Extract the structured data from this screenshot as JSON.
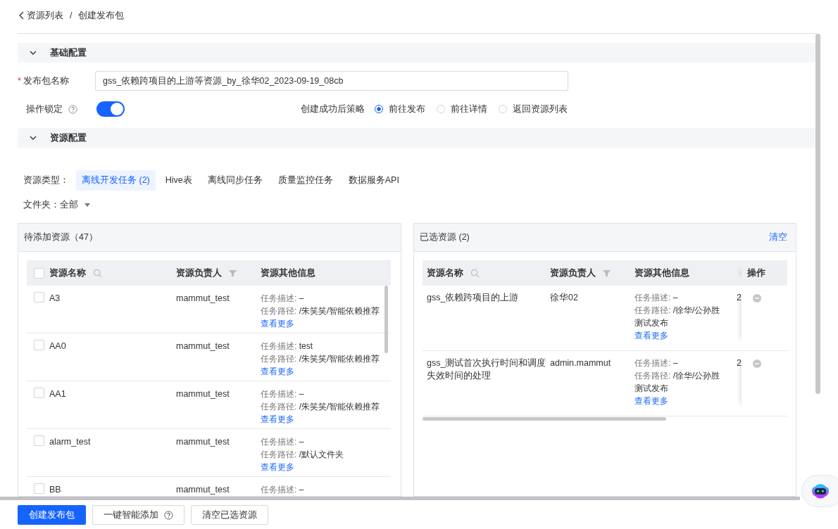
{
  "breadcrumb": {
    "back": "资源列表",
    "separator": "/",
    "current": "创建发布包"
  },
  "sections": [
    {
      "title": "基础配置",
      "expanded": true
    },
    {
      "title": "资源配置",
      "expanded": true
    }
  ],
  "basic": {
    "name_field": {
      "label": "发布包名称",
      "required_mark": "*",
      "value": "gss_依赖跨项目的上游等资源_by_徐华02_2023-09-19_08cb"
    },
    "lock": {
      "label": "操作锁定",
      "on": true
    },
    "strategy": {
      "label": "创建成功后策略",
      "options": [
        {
          "label": "前往发布",
          "selected": true
        },
        {
          "label": "前往详情",
          "selected": false
        },
        {
          "label": "返回资源列表",
          "selected": false
        }
      ]
    }
  },
  "resource": {
    "type_label": "资源类型：",
    "types": [
      {
        "label": "离线开发任务 (2)",
        "selected": true
      },
      {
        "label": "Hive表",
        "selected": false
      },
      {
        "label": "离线同步任务",
        "selected": false
      },
      {
        "label": "质量监控任务",
        "selected": false
      },
      {
        "label": "数据服务API",
        "selected": false
      }
    ],
    "folder": {
      "label": "文件夹：",
      "value": "全部"
    }
  },
  "pending": {
    "title": "待添加资源（47）",
    "all_checked": false,
    "columns": [
      "资源名称",
      "资源负责人",
      "资源其他信息"
    ],
    "rows": [
      {
        "checked": false,
        "name": "A3",
        "owner": "mammut_test",
        "info": [
          "任务描述: –",
          "任务路径: /朱笑笑/智能依赖推荐"
        ],
        "more": "查看更多"
      },
      {
        "checked": false,
        "name": "AA0",
        "owner": "mammut_test",
        "info": [
          "任务描述: test",
          "任务路径: /朱笑笑/智能依赖推荐"
        ],
        "more": "查看更多"
      },
      {
        "checked": false,
        "name": "AA1",
        "owner": "mammut_test",
        "info": [
          "任务描述: –",
          "任务路径: /朱笑笑/智能依赖推荐"
        ],
        "more": "查看更多"
      },
      {
        "checked": false,
        "name": "alarm_test",
        "owner": "mammut_test",
        "info": [
          "任务描述: –",
          "任务路径: /默认文件夹"
        ],
        "more": "查看更多"
      },
      {
        "checked": false,
        "name": "BB",
        "owner": "mammut_test",
        "info": [
          "任务描述: –"
        ]
      }
    ]
  },
  "selected": {
    "title": "已选资源 (2)",
    "clear": "清空",
    "columns": [
      "资源名称",
      "资源负责人",
      "资源其他信息",
      "操作"
    ],
    "rows": [
      {
        "name": "gss_依赖跨项目的上游",
        "owner": "徐华02",
        "info": [
          "任务描述: –",
          "任务路径: /徐华/公孙胜测试发布"
        ],
        "more": "查看更多",
        "column_4": "2"
      },
      {
        "name": "gss_测试首次执行时间和调度失效时间的处理",
        "owner": "admin.mammut",
        "info": [
          "任务描述: –",
          "任务路径: /徐华/公孙胜测试发布"
        ],
        "more": "查看更多",
        "column_4": "2"
      }
    ]
  },
  "actions": [
    {
      "label": "创建发布包",
      "kind": "primary"
    },
    {
      "label": "一键智能添加",
      "kind": "help"
    },
    {
      "label": "清空已选资源",
      "kind": "plain"
    }
  ]
}
